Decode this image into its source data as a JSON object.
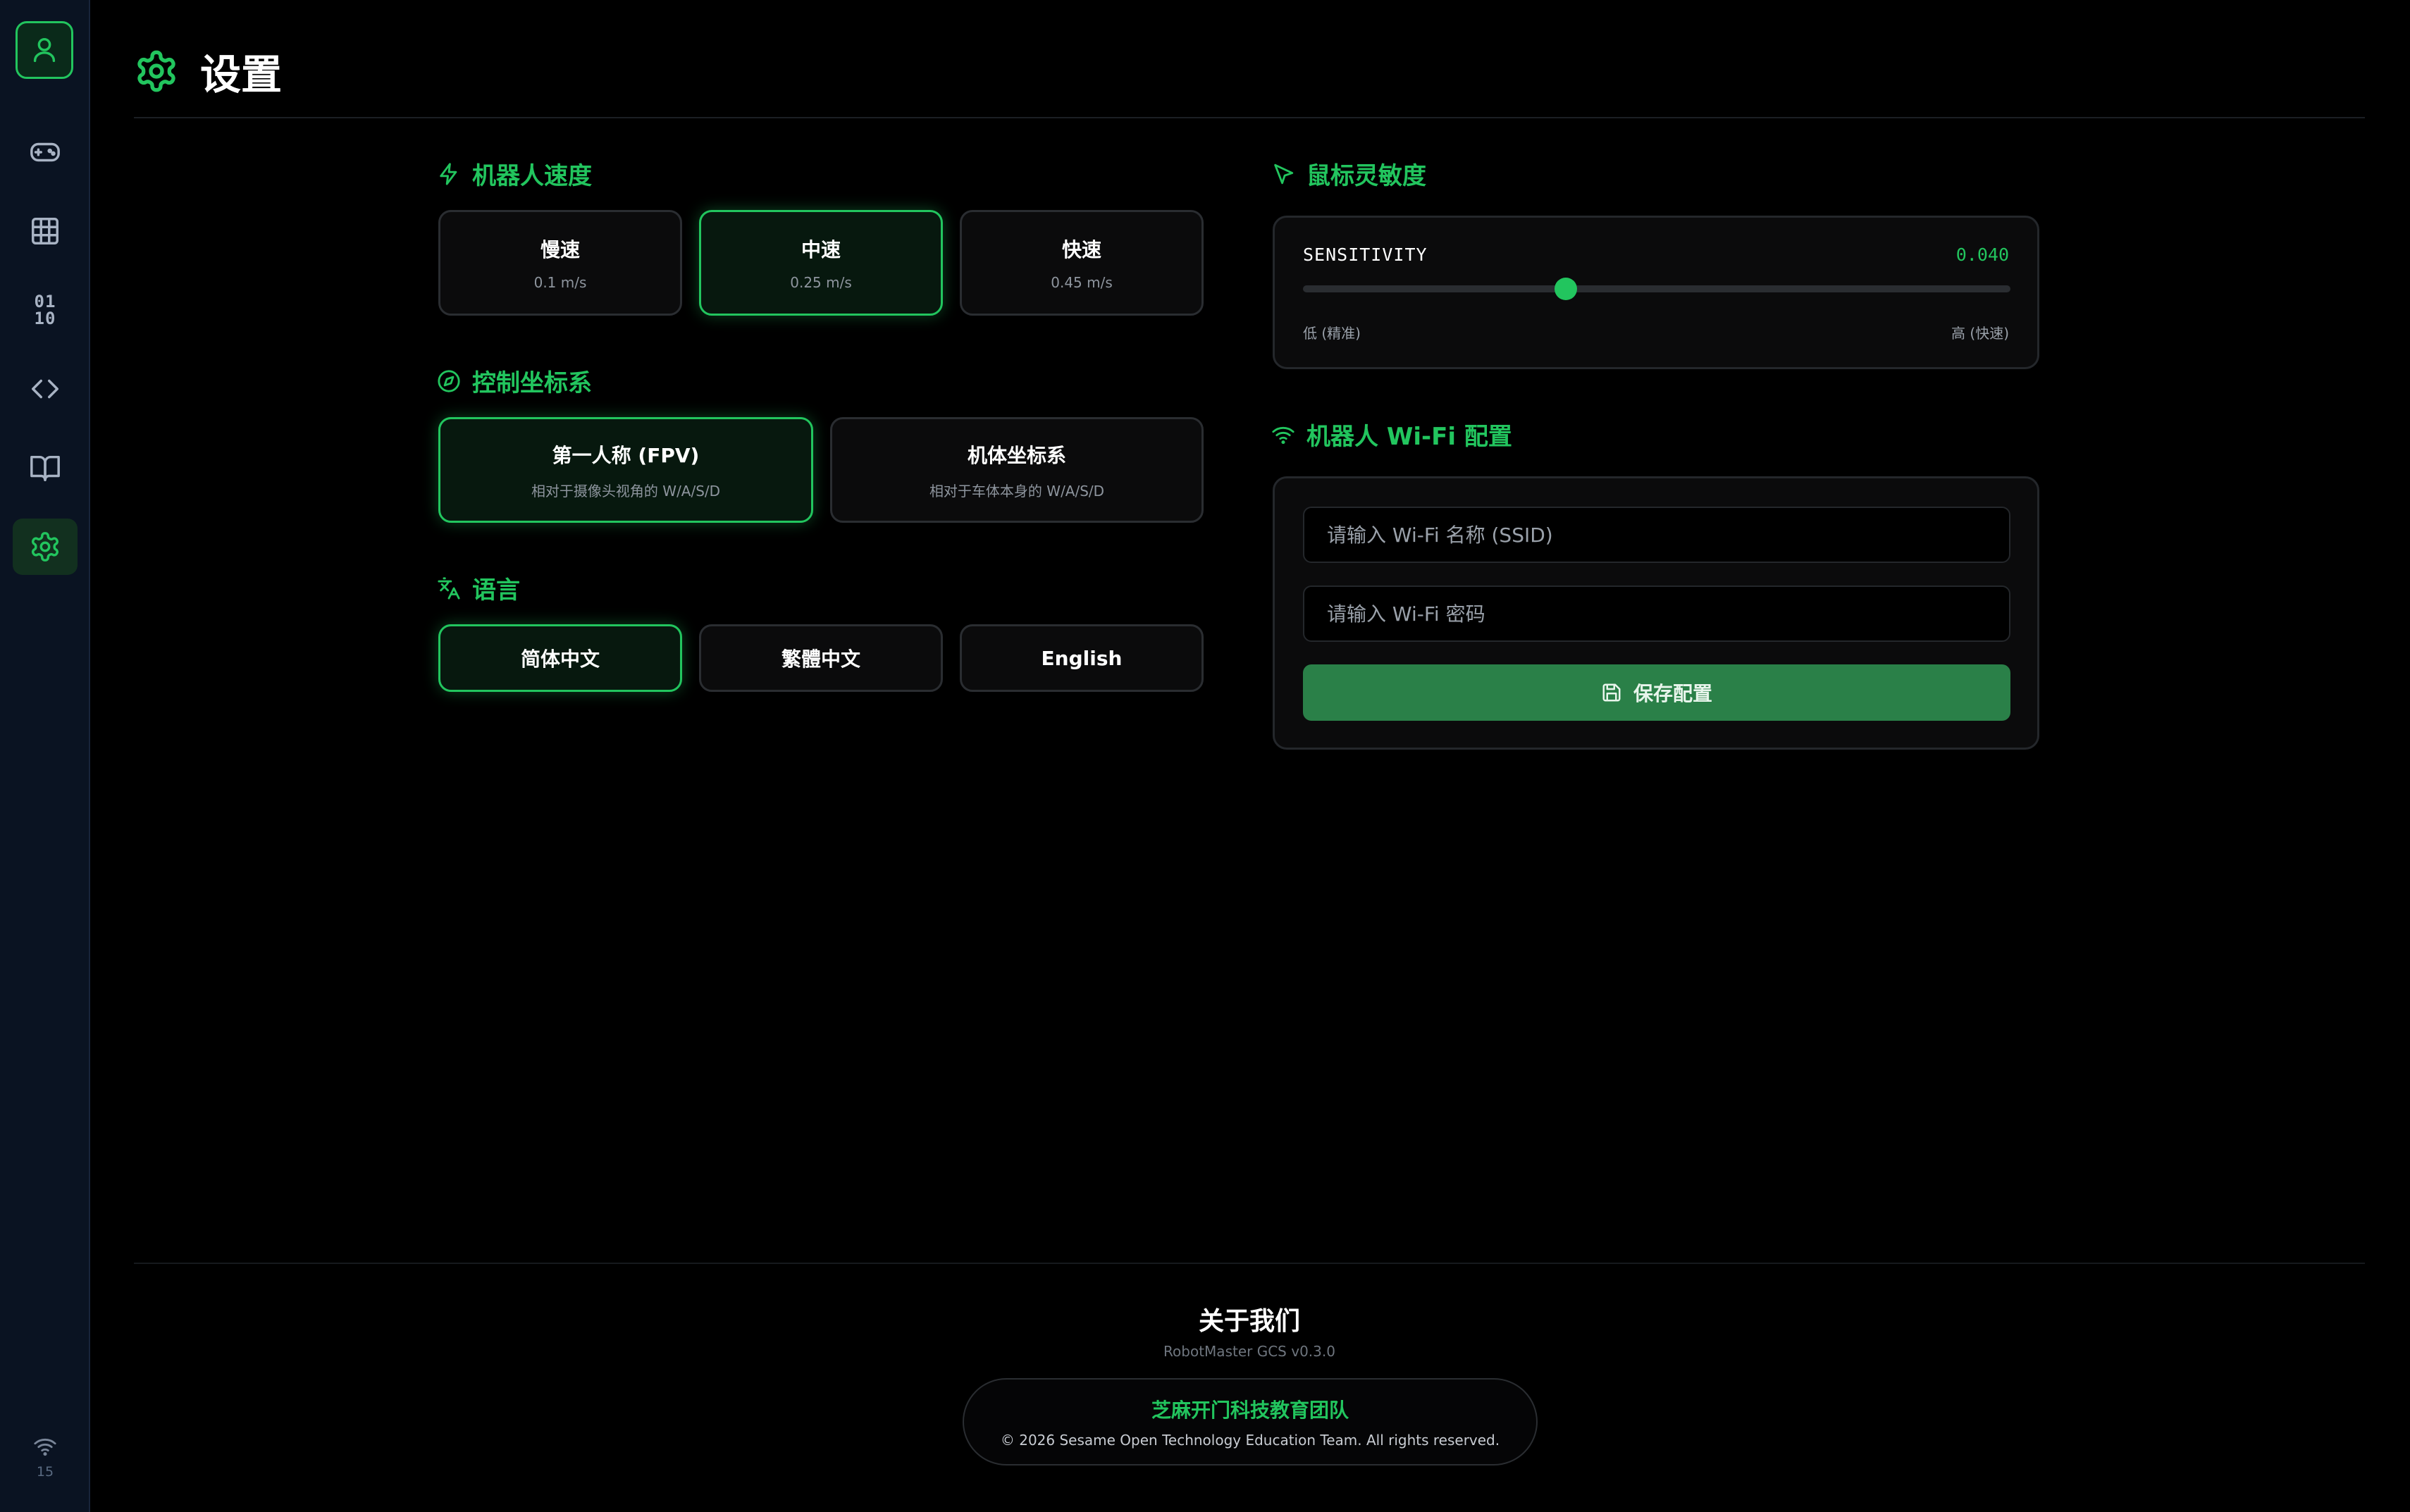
{
  "page": {
    "title": "设置",
    "accent_color": "#22c55e"
  },
  "sidebar": {
    "items": [
      {
        "icon": "user-icon",
        "active": false
      },
      {
        "icon": "gamepad-icon",
        "active": false
      },
      {
        "icon": "grid-icon",
        "active": false
      },
      {
        "icon": "binary-icon",
        "label": "01 10",
        "active": false
      },
      {
        "icon": "code-icon",
        "active": false
      },
      {
        "icon": "book-icon",
        "active": false
      },
      {
        "icon": "gear-icon",
        "active": true
      }
    ],
    "wifi_count": "15"
  },
  "speed": {
    "title": "机器人速度",
    "options": [
      {
        "label": "慢速",
        "value": "0.1 m/s"
      },
      {
        "label": "中速",
        "value": "0.25 m/s"
      },
      {
        "label": "快速",
        "value": "0.45 m/s"
      }
    ],
    "selected": 1
  },
  "coordinate": {
    "title": "控制坐标系",
    "options": [
      {
        "label": "第一人称 (FPV)",
        "desc": "相对于摄像头视角的 W/A/S/D"
      },
      {
        "label": "机体坐标系",
        "desc": "相对于车体本身的 W/A/S/D"
      }
    ],
    "selected": 0
  },
  "language": {
    "title": "语言",
    "options": [
      "简体中文",
      "繁體中文",
      "English"
    ],
    "selected": 0
  },
  "mouse": {
    "title": "鼠标灵敏度",
    "label": "SENSITIVITY",
    "value": "0.040",
    "slider_fraction": 0.372,
    "low_label": "低 (精准)",
    "high_label": "高 (快速)"
  },
  "wifi": {
    "title": "机器人 Wi-Fi 配置",
    "ssid_placeholder": "请输入 Wi-Fi 名称 (SSID)",
    "password_placeholder": "请输入 Wi-Fi 密码",
    "save_label": "保存配置"
  },
  "footer": {
    "about_title": "关于我们",
    "version": "RobotMaster GCS v0.3.0",
    "team": "芝麻开门科技教育团队",
    "copyright": "© 2026 Sesame Open Technology Education Team. All rights reserved."
  }
}
